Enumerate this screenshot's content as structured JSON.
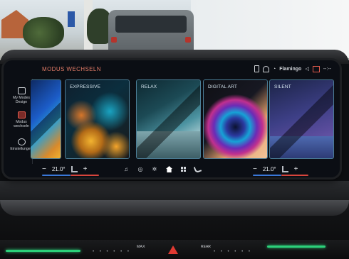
{
  "screen": {
    "title": "MODUS WECHSELN",
    "status": {
      "station": "Flamingo",
      "signal": "--:--"
    },
    "sidebar": [
      {
        "label": "My Modes Design",
        "icon": "my-modes-icon",
        "active": false
      },
      {
        "label": "Modus wechseln",
        "icon": "modus-wechseln-icon",
        "active": true
      },
      {
        "label": "Einstellungen",
        "icon": "gear-icon",
        "active": false
      }
    ],
    "modes": [
      {
        "name": "",
        "style": "left"
      },
      {
        "name": "EXPRESSIVE",
        "style": "expressive"
      },
      {
        "name": "RELAX",
        "style": "relax"
      },
      {
        "name": "DIGITAL ART",
        "style": "digital"
      },
      {
        "name": "SILENT",
        "style": "silent"
      }
    ],
    "climate": {
      "left": {
        "minus": "−",
        "value": "21.0°",
        "plus": "+"
      },
      "right": {
        "minus": "−",
        "value": "21.0°",
        "plus": "+"
      }
    },
    "dock": [
      {
        "icon": "music-icon",
        "glyph": "♫"
      },
      {
        "icon": "navigation-icon",
        "glyph": "◎"
      },
      {
        "icon": "fan-icon",
        "glyph": "✲"
      },
      {
        "icon": "home-icon",
        "glyph": ""
      },
      {
        "icon": "apps-grid-icon",
        "glyph": ""
      },
      {
        "icon": "phone-icon",
        "glyph": ""
      }
    ]
  },
  "console": {
    "max_label": "MAX",
    "rear_label": "REAR"
  },
  "colors": {
    "accent": "#e05a4c",
    "ambient_led": "#2cd07a",
    "card_border": "#4b7d96"
  }
}
